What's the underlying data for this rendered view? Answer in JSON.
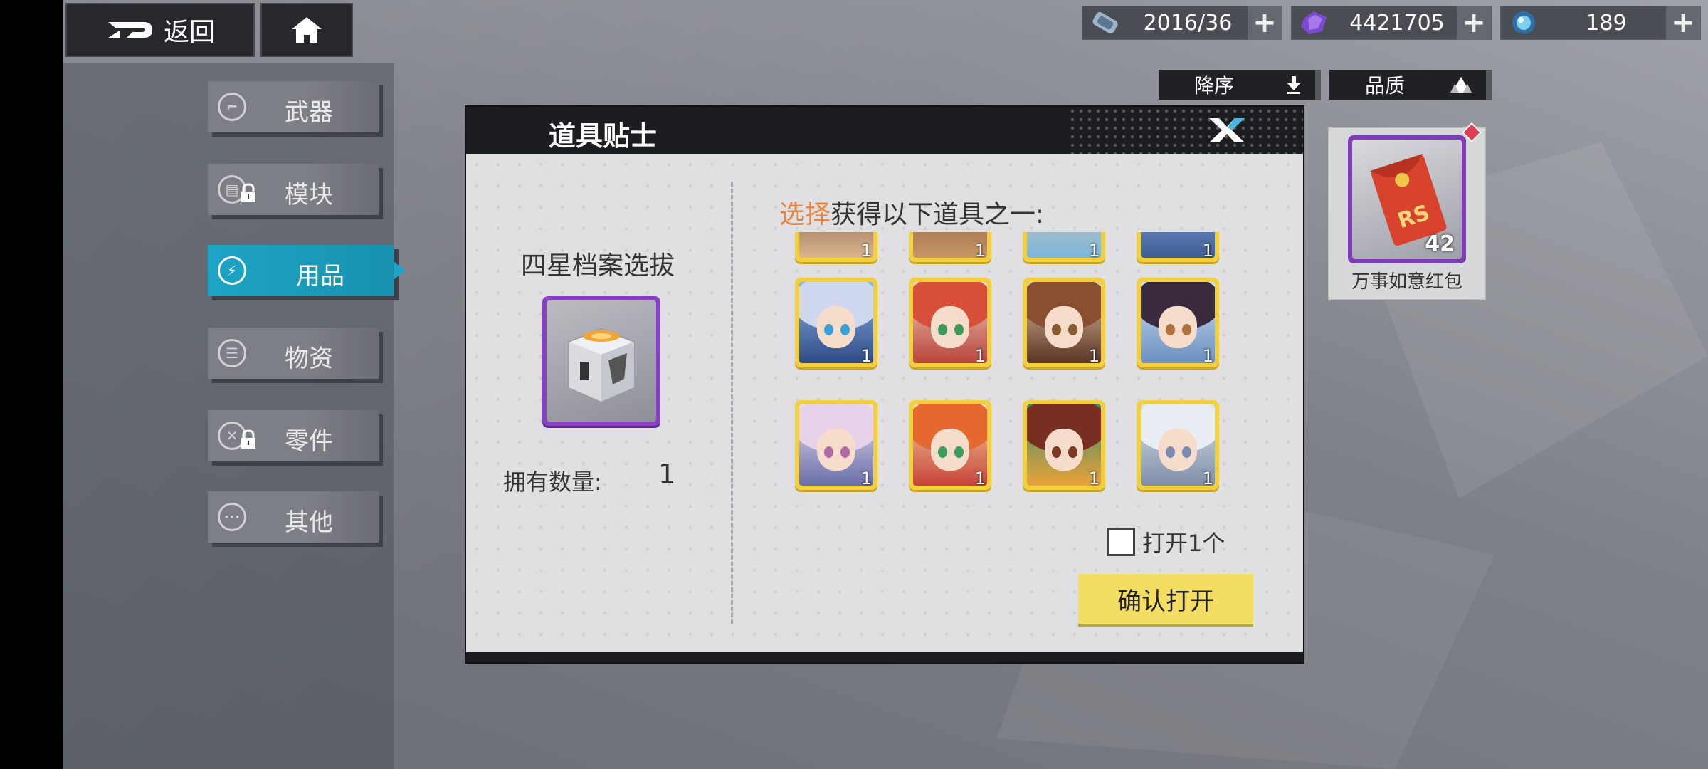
{
  "top_bar": {
    "back_label": "返回",
    "resources": [
      {
        "icon": "stamina-icon",
        "value": "2016/36"
      },
      {
        "icon": "crystal-icon",
        "value": "4421705"
      },
      {
        "icon": "orb-icon",
        "value": "189"
      }
    ],
    "plus_symbol": "+"
  },
  "sort": {
    "label": "降序"
  },
  "filter": {
    "label": "品质"
  },
  "sidebar": {
    "items": [
      {
        "label": "武器",
        "locked": false
      },
      {
        "label": "模块",
        "locked": true
      },
      {
        "label": "用品",
        "active": true
      },
      {
        "label": "物资",
        "locked": false
      },
      {
        "label": "零件",
        "locked": true
      },
      {
        "label": "其他",
        "locked": false
      }
    ]
  },
  "item_card": {
    "name": "万事如意红包",
    "count": "42"
  },
  "dialog": {
    "title": "道具贴士",
    "box_name": "四星档案选拔",
    "own_label": "拥有数量:",
    "own_value": "1",
    "select_highlight": "选择",
    "select_rest": "获得以下道具之一:",
    "tile_qty": "1",
    "open_one_label": "打开1个",
    "confirm_label": "确认打开"
  },
  "colors": {
    "accent_blue": "#1da4c5",
    "gold_frame": "#f4cf3c",
    "purple_frame": "#8a3fc6",
    "confirm_yellow": "#f3dd63",
    "highlight_orange": "#e9843a"
  }
}
